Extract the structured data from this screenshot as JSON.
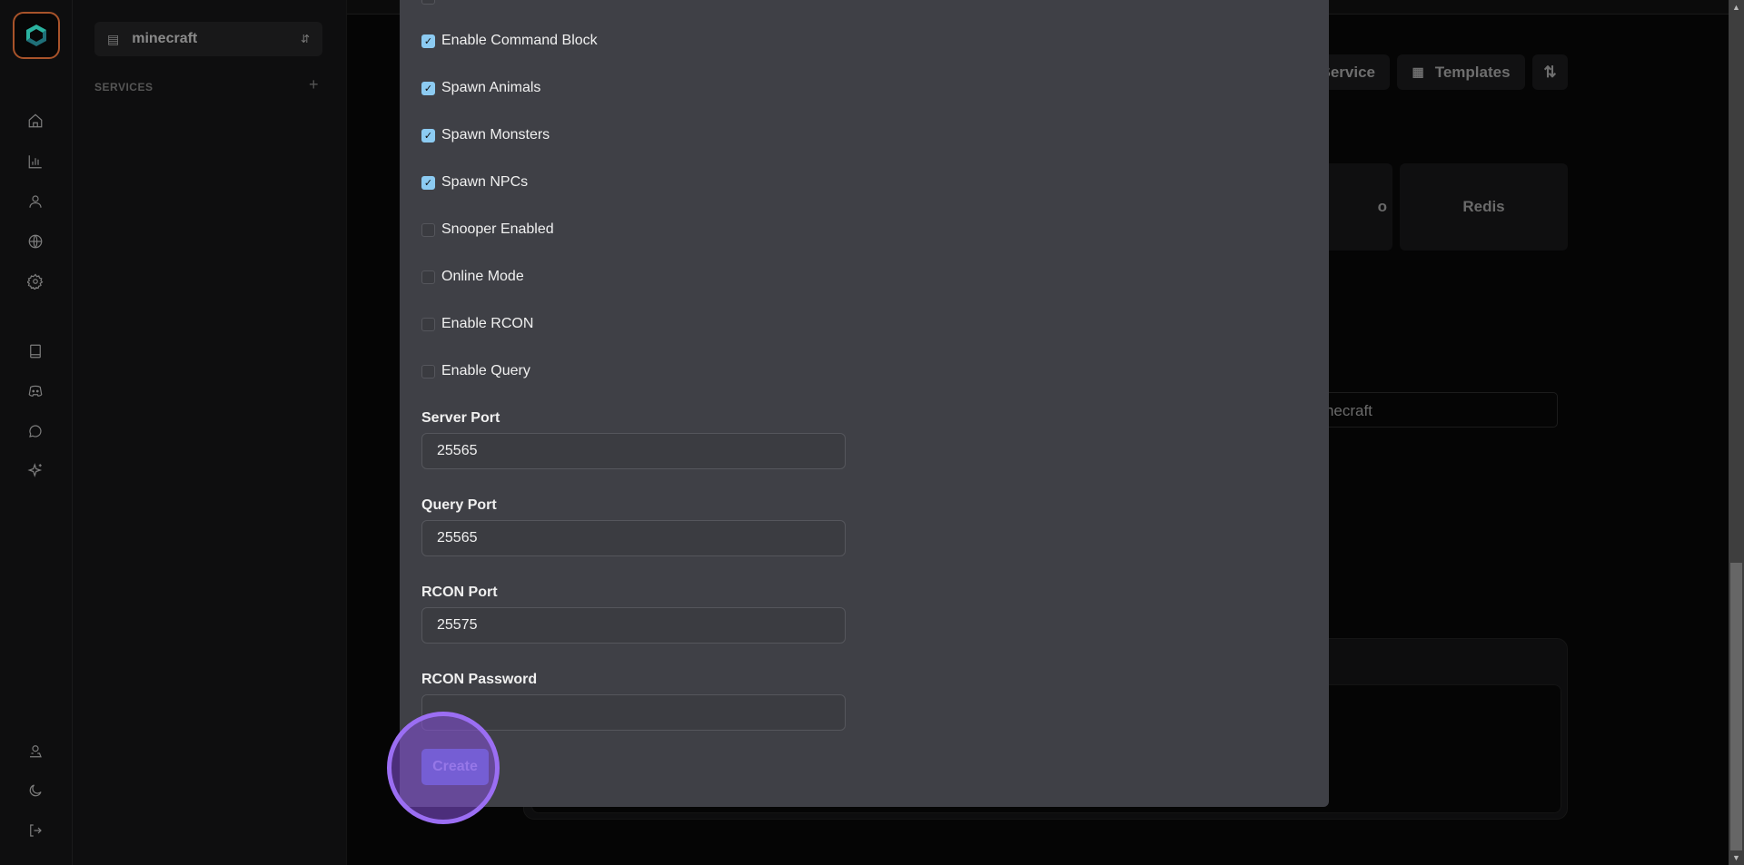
{
  "sidebar": {
    "project": "minecraft",
    "services_heading": "SERVICES"
  },
  "main": {
    "buttons": {
      "service": "Service",
      "templates": "Templates"
    },
    "cards": [
      "o",
      "Redis"
    ],
    "name_input": "minecraft"
  },
  "dialog": {
    "checkboxes": [
      {
        "label": "Enable Command Block",
        "checked": true
      },
      {
        "label": "Spawn Animals",
        "checked": true
      },
      {
        "label": "Spawn Monsters",
        "checked": true
      },
      {
        "label": "Spawn NPCs",
        "checked": true
      },
      {
        "label": "Snooper Enabled",
        "checked": false
      },
      {
        "label": "Online Mode",
        "checked": false
      },
      {
        "label": "Enable RCON",
        "checked": false
      },
      {
        "label": "Enable Query",
        "checked": false
      }
    ],
    "fields": [
      {
        "label": "Server Port",
        "value": "25565"
      },
      {
        "label": "Query Port",
        "value": "25565"
      },
      {
        "label": "RCON Port",
        "value": "25575"
      },
      {
        "label": "RCON Password",
        "value": ""
      }
    ],
    "create_label": "Create"
  },
  "colors": {
    "dialog_bg": "#3f4046",
    "checkbox_checked": "#8ccbf2",
    "create_button": "#5f6fc9",
    "highlight": "#9b6ef3",
    "logo_border": "#a8532a"
  }
}
